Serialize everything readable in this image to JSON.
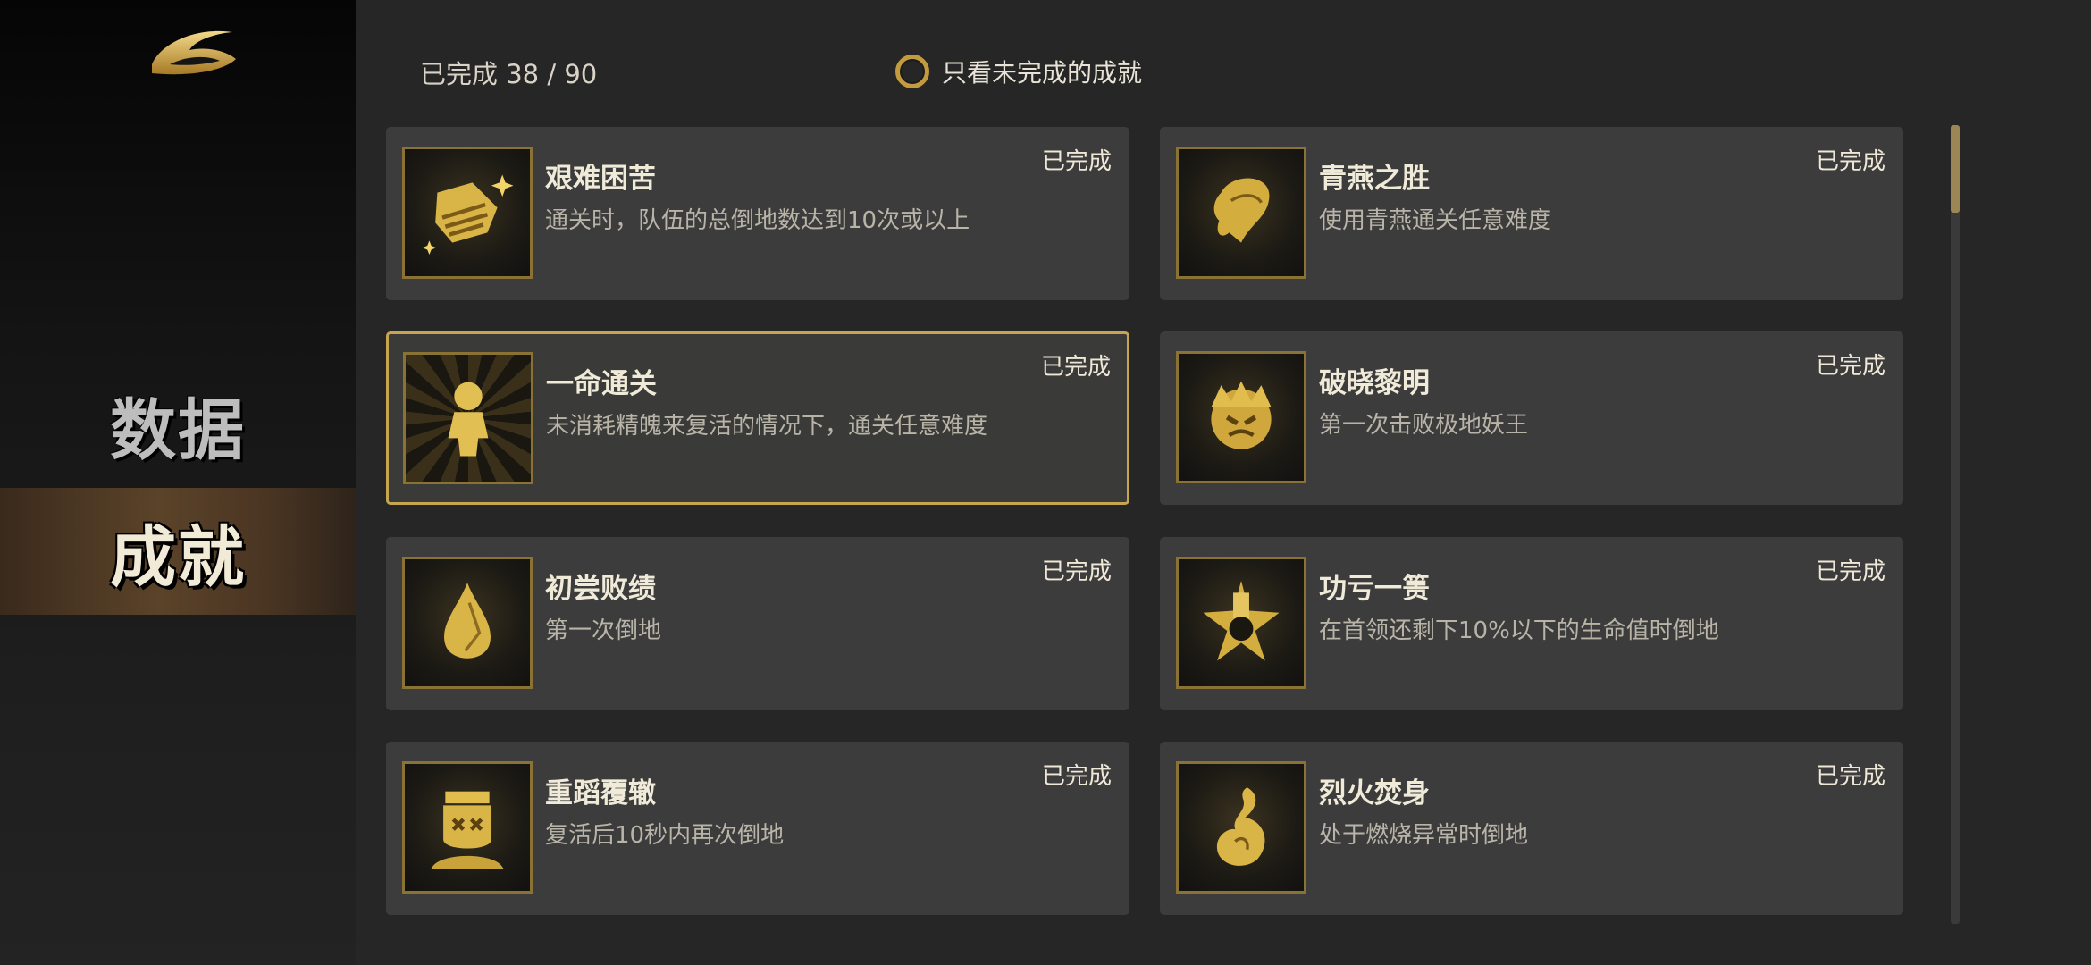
{
  "sidebar": {
    "logo_icon": "swirl-logo-icon",
    "items": [
      {
        "label": "数据",
        "active": false
      },
      {
        "label": "成就",
        "active": true
      }
    ]
  },
  "header": {
    "progress_text": "已完成 38 / 90",
    "filter_label": "只看未完成的成就",
    "filter_checked": false
  },
  "achievements": [
    {
      "title": "艰难困苦",
      "desc": "通关时，队伍的总倒地数达到10次或以上",
      "status": "已完成",
      "icon": "bandaged-hand-icon"
    },
    {
      "title": "青燕之胜",
      "desc": "使用青燕通关任意难度",
      "status": "已完成",
      "icon": "swallow-helmet-icon"
    },
    {
      "title": "一命通关",
      "desc": "未消耗精魄来复活的情况下，通关任意难度",
      "status": "已完成",
      "icon": "standing-figure-icon"
    },
    {
      "title": "破晓黎明",
      "desc": "第一次击败极地妖王",
      "status": "已完成",
      "icon": "demon-king-icon"
    },
    {
      "title": "初尝败绩",
      "desc": "第一次倒地",
      "status": "已完成",
      "icon": "teardrop-icon"
    },
    {
      "title": "功亏一篑",
      "desc": "在首领还剩下10%以下的生命值时倒地",
      "status": "已完成",
      "icon": "broken-vase-icon"
    },
    {
      "title": "重蹈覆辙",
      "desc": "复活后10秒内再次倒地",
      "status": "已完成",
      "icon": "knocked-out-face-icon"
    },
    {
      "title": "烈火焚身",
      "desc": "处于燃烧异常时倒地",
      "status": "已完成",
      "icon": "flame-icon"
    }
  ],
  "colors": {
    "accent_gold": "#c6a551",
    "card_bg": "#3c3c3c",
    "page_bg": "#262626"
  }
}
